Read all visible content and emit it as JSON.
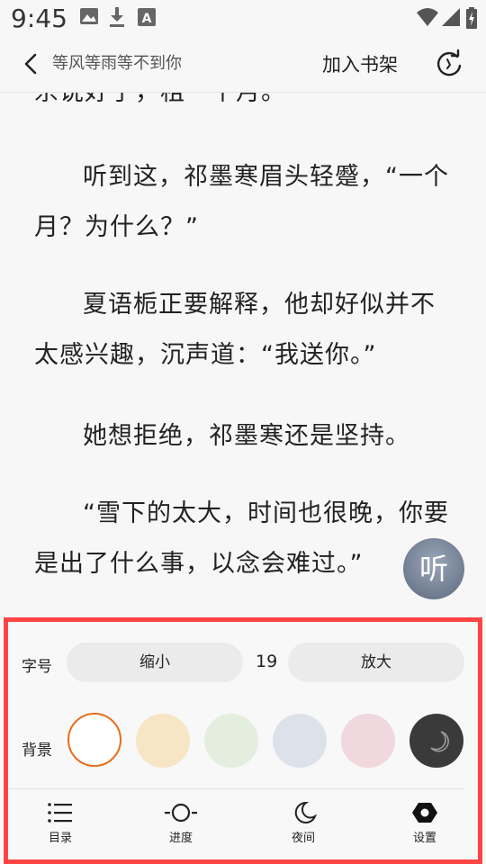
{
  "status_bar": {
    "time": "9:45"
  },
  "top_bar": {
    "book_title": "等风等雨等不到你",
    "add_to_shelf": "加入书架"
  },
  "reader": {
    "cut_line": "杀说好了，租一个月。",
    "paragraphs": [
      "听到这，祁墨寒眉头轻蹙，“一个月？为什么？”",
      "夏语栀正要解释，他却好似并不太感兴趣，沉声道：“我送你。”",
      "她想拒绝，祁墨寒还是坚持。",
      "“雪下的太大，时间也很晚，你要是出了什么事，以念会难过。”"
    ],
    "listen_label": "听"
  },
  "settings": {
    "font_label": "字号",
    "shrink_label": "缩小",
    "font_size": "19",
    "enlarge_label": "放大",
    "bg_label": "背景",
    "backgrounds": [
      {
        "name": "white",
        "color": "#ffffff",
        "selected": true
      },
      {
        "name": "yellow",
        "color": "#f6e6c6"
      },
      {
        "name": "green",
        "color": "#e4eedf"
      },
      {
        "name": "blue-gray",
        "color": "#dde2ea"
      },
      {
        "name": "pink",
        "color": "#f0d8de"
      },
      {
        "name": "night",
        "color": "#3a3a3a",
        "icon": "moon-icon"
      }
    ],
    "accent_color": "#e86d1c"
  },
  "bottom_nav": {
    "items": [
      {
        "label": "目录",
        "icon": "list-icon"
      },
      {
        "label": "进度",
        "icon": "progress-icon"
      },
      {
        "label": "夜间",
        "icon": "moon-icon"
      },
      {
        "label": "设置",
        "icon": "settings-icon"
      }
    ]
  }
}
